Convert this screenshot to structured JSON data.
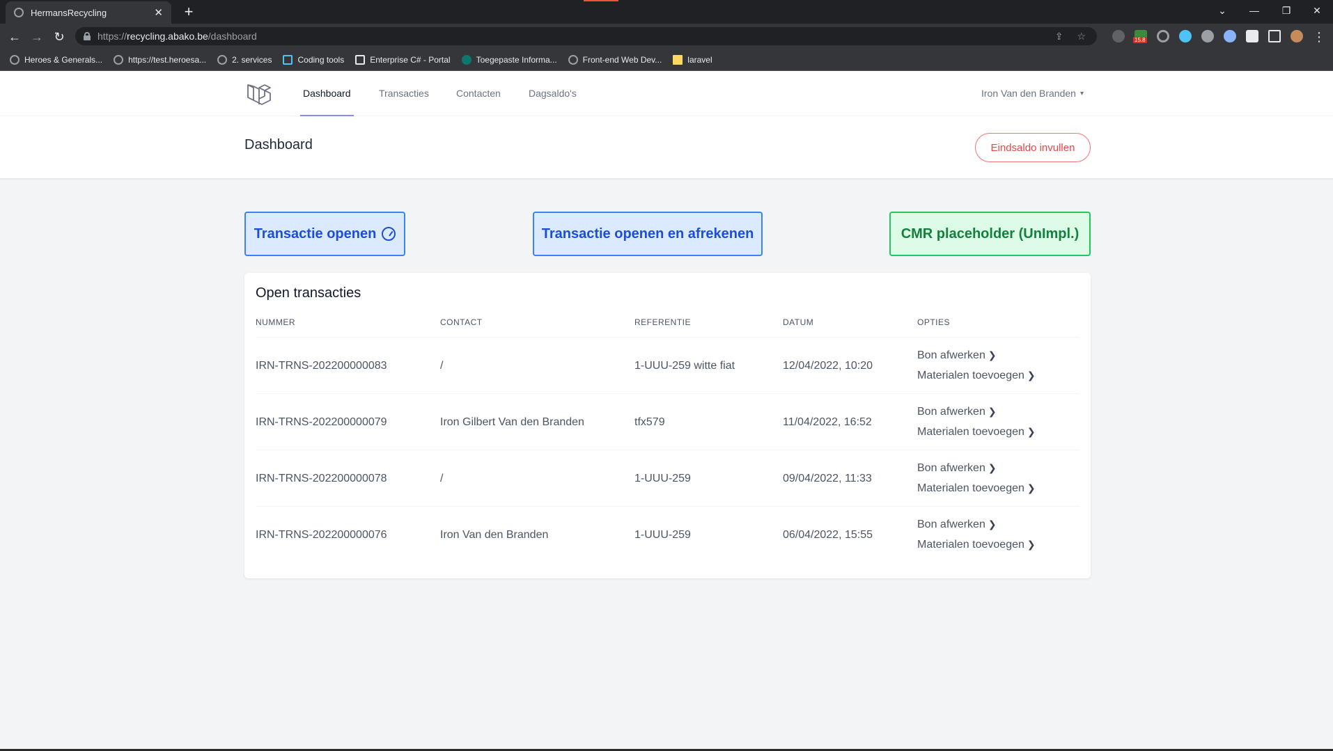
{
  "browser": {
    "tab_title": "HermansRecycling",
    "url_scheme": "https://",
    "url_host": "recycling.abako.be",
    "url_path": "/dashboard",
    "bookmarks": [
      "Heroes & Generals...",
      "https://test.heroesa...",
      "2. services",
      "Coding tools",
      "Enterprise C# - Portal",
      "Toegepaste Informa...",
      "Front-end Web Dev...",
      "laravel"
    ],
    "extension_badge": "15.8"
  },
  "nav": {
    "links": [
      "Dashboard",
      "Transacties",
      "Contacten",
      "Dagsaldo's"
    ],
    "active": "Dashboard",
    "user": "Iron Van den Branden"
  },
  "header": {
    "title": "Dashboard",
    "eindsaldo_label": "Eindsaldo invullen"
  },
  "actions": {
    "open": "Transactie openen",
    "open_afrekenen": "Transactie openen en afrekenen",
    "cmr": "CMR placeholder (UnImpl.)"
  },
  "table": {
    "title": "Open transacties",
    "columns": [
      "NUMMER",
      "CONTACT",
      "REFERENTIE",
      "DATUM",
      "OPTIES"
    ],
    "option_labels": [
      "Bon afwerken",
      "Materialen toevoegen"
    ],
    "rows": [
      {
        "nummer": "IRN-TRNS-202200000083",
        "contact": "/",
        "referentie": "1-UUU-259 witte fiat",
        "datum": "12/04/2022, 10:20"
      },
      {
        "nummer": "IRN-TRNS-202200000079",
        "contact": "Iron Gilbert Van den Branden",
        "referentie": "tfx579",
        "datum": "11/04/2022, 16:52"
      },
      {
        "nummer": "IRN-TRNS-202200000078",
        "contact": "/",
        "referentie": "1-UUU-259",
        "datum": "09/04/2022, 11:33"
      },
      {
        "nummer": "IRN-TRNS-202200000076",
        "contact": "Iron Van den Branden",
        "referentie": "1-UUU-259",
        "datum": "06/04/2022, 15:55"
      }
    ]
  }
}
